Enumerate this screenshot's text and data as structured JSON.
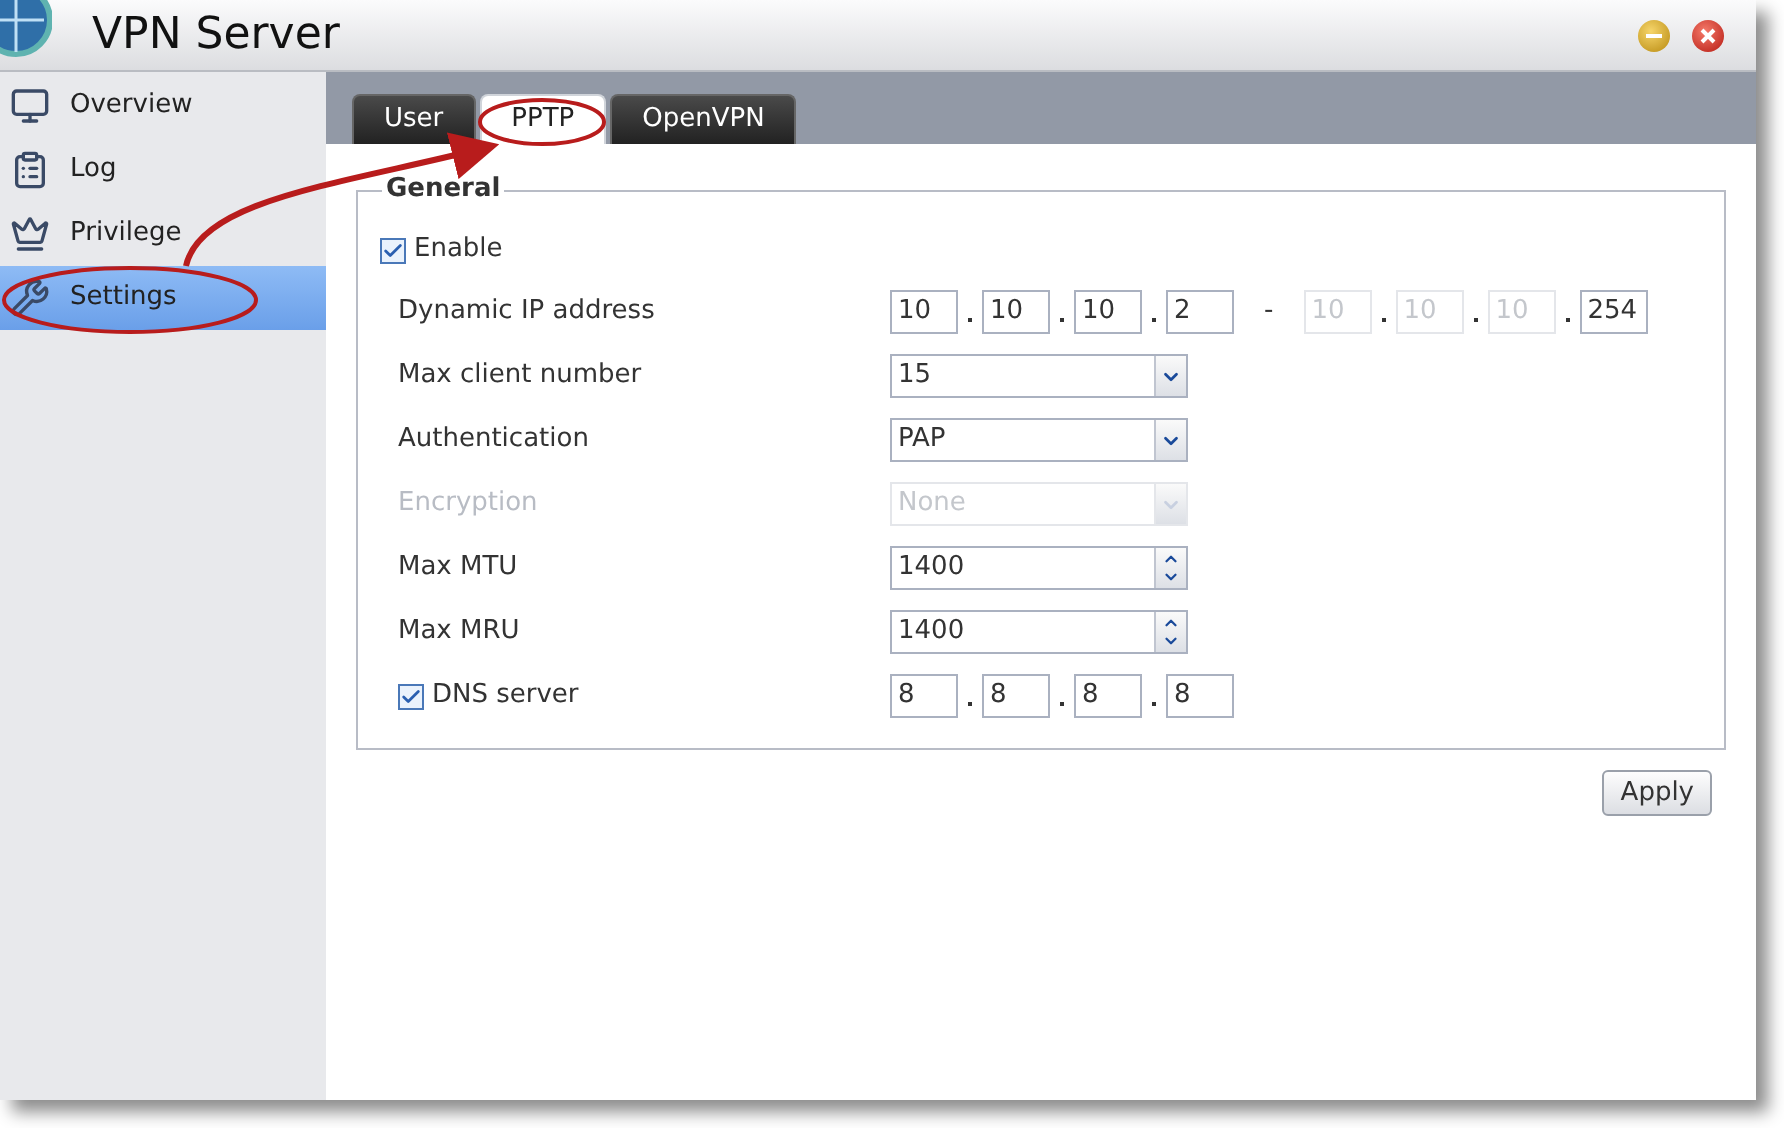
{
  "window": {
    "title": "VPN Server"
  },
  "sidebar": {
    "items": [
      {
        "label": "Overview",
        "selected": false
      },
      {
        "label": "Log",
        "selected": false
      },
      {
        "label": "Privilege",
        "selected": false
      },
      {
        "label": "Settings",
        "selected": true
      }
    ]
  },
  "tabs": [
    {
      "label": "User",
      "selected": false
    },
    {
      "label": "PPTP",
      "selected": true
    },
    {
      "label": "OpenVPN",
      "selected": false
    }
  ],
  "section": {
    "title": "General",
    "enable": {
      "label": "Enable",
      "checked": true
    },
    "rows": [
      {
        "kind": "ip_range",
        "label": "Dynamic IP address",
        "disabled": false,
        "start": [
          {
            "value": "10",
            "disabled": false
          },
          {
            "value": "10",
            "disabled": false
          },
          {
            "value": "10",
            "disabled": false
          },
          {
            "value": "2",
            "disabled": false
          }
        ],
        "separator": "-",
        "end": [
          {
            "value": "10",
            "disabled": true
          },
          {
            "value": "10",
            "disabled": true
          },
          {
            "value": "10",
            "disabled": true
          },
          {
            "value": "254",
            "disabled": false
          }
        ]
      },
      {
        "kind": "select",
        "label": "Max client number",
        "disabled": false,
        "value": "15"
      },
      {
        "kind": "select",
        "label": "Authentication",
        "disabled": false,
        "value": "PAP"
      },
      {
        "kind": "select",
        "label": "Encryption",
        "disabled": true,
        "value": "None"
      },
      {
        "kind": "spin",
        "label": "Max MTU",
        "disabled": false,
        "value": "1400"
      },
      {
        "kind": "spin",
        "label": "Max MRU",
        "disabled": false,
        "value": "1400"
      },
      {
        "kind": "check_ip",
        "label": "DNS server",
        "disabled": false,
        "checked": true,
        "octets": [
          {
            "value": "8",
            "disabled": false
          },
          {
            "value": "8",
            "disabled": false
          },
          {
            "value": "8",
            "disabled": false
          },
          {
            "value": "8",
            "disabled": false
          }
        ]
      }
    ]
  },
  "apply_button": "Apply"
}
